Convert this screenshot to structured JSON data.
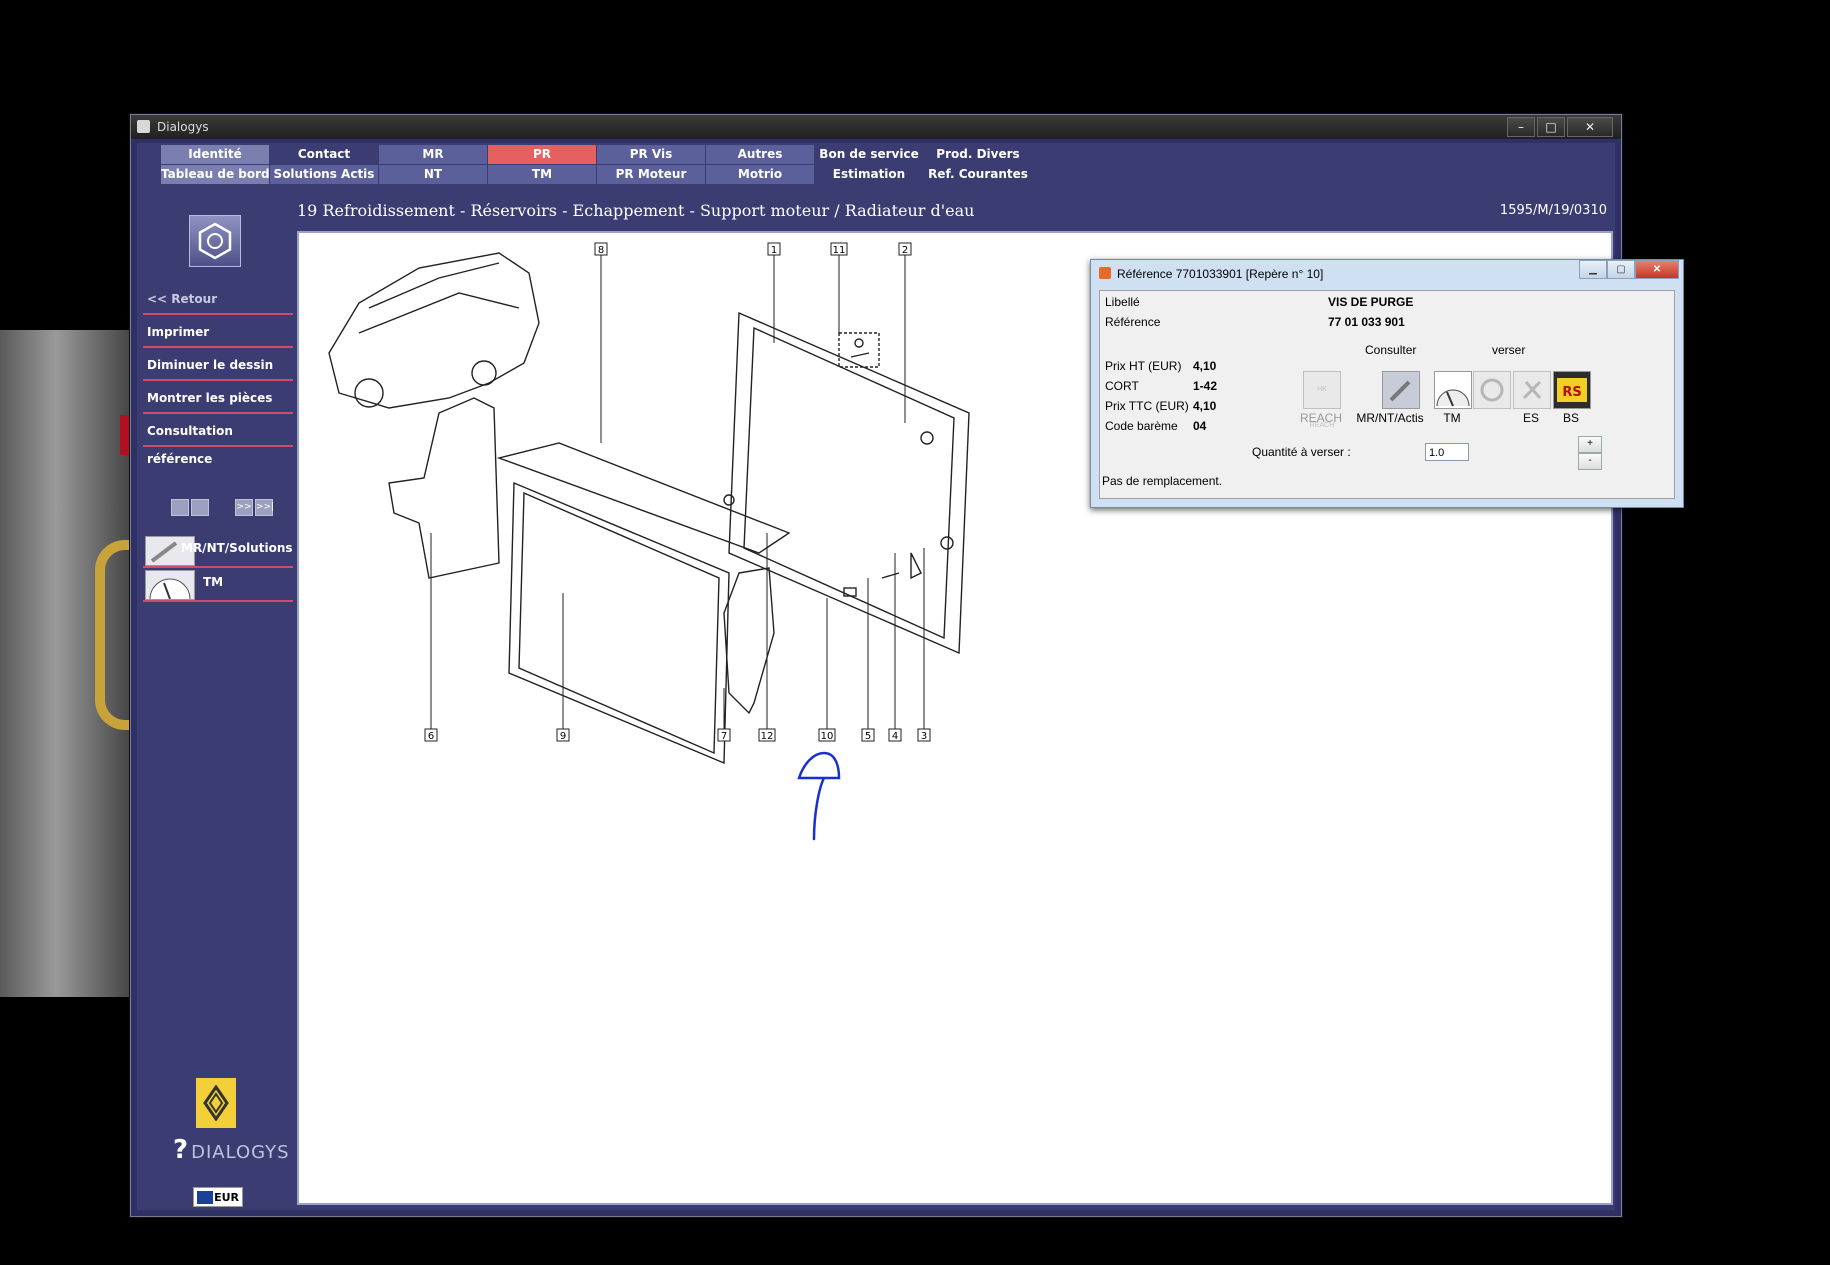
{
  "window": {
    "title": "Dialogys",
    "controls": [
      "–",
      "□",
      "✕"
    ]
  },
  "nav": {
    "row1": [
      "Identité",
      "Contact",
      "MR",
      "PR",
      "PR Vis",
      "Autres",
      "Bon de service",
      "Prod. Divers"
    ],
    "row2": [
      "Tableau de bord",
      "Solutions Actis",
      "NT",
      "TM",
      "PR Moteur",
      "Motrio",
      "Estimation",
      "Ref. Courantes"
    ],
    "active": "PR"
  },
  "sidebar": {
    "back": "<< Retour",
    "items": [
      "Imprimer",
      "Diminuer le dessin",
      "Montrer les pièces",
      "Consultation référence"
    ],
    "pagers": [
      "",
      "",
      ">>",
      ">>|"
    ],
    "tools": [
      "MR/NT/Solutions ...",
      "TM"
    ],
    "brand": "DIALOGYS",
    "currency": "EUR"
  },
  "header": {
    "breadcrumb": "19 Refroidissement - Réservoirs - Echappement - Support moteur / Radiateur d'eau",
    "code": "1595/M/19/0310"
  },
  "diagram": {
    "callouts": [
      "8",
      "1",
      "11",
      "2",
      "6",
      "9",
      "7",
      "12",
      "10",
      "5",
      "4",
      "3"
    ]
  },
  "dialog": {
    "title": "Référence 7701033901 [Repère n° 10]",
    "libelle_label": "Libellé",
    "libelle_value": "VIS DE PURGE",
    "reference_label": "Référence",
    "reference_value": "77 01 033 901",
    "prix_ht_label": "Prix HT (EUR)",
    "prix_ht_value": "4,10",
    "cort_label": "CORT",
    "cort_value": "1-42",
    "prix_ttc_label": "Prix TTC (EUR)",
    "prix_ttc_value": "4,10",
    "bareme_label": "Code barème",
    "bareme_value": "04",
    "consulter_label": "Consulter",
    "verser_label": "verser",
    "reach_label": "REACH",
    "reach_icon_text": "HK REACH",
    "mr_label": "MR/NT/Actis",
    "tm_label": "TM",
    "es_label": "ES",
    "bs_label": "BS",
    "quantite_label": "Quantité à verser :",
    "quantite_value": "1.0",
    "plus": "+",
    "minus": "-",
    "remplacement": "Pas de remplacement."
  }
}
